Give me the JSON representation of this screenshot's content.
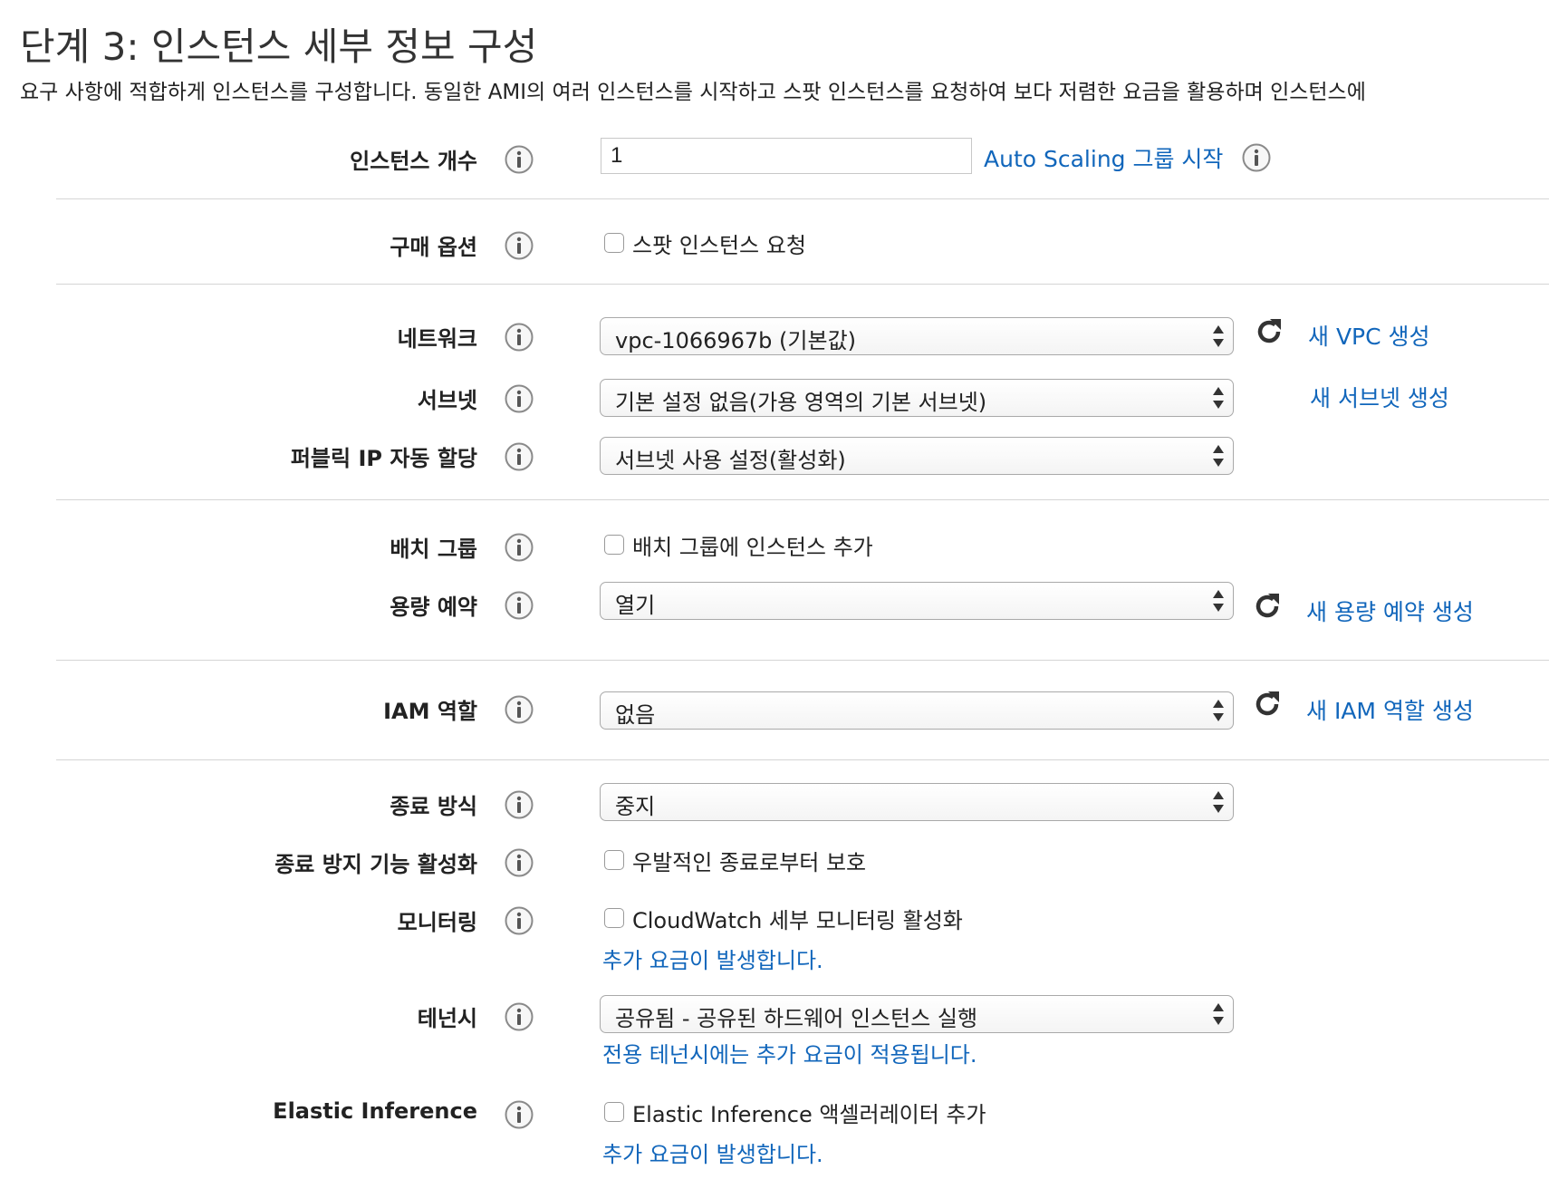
{
  "page": {
    "title": "단계 3: 인스턴스 세부 정보 구성",
    "description": "요구 사항에 적합하게 인스턴스를 구성합니다. 동일한 AMI의 여러 인스턴스를 시작하고 스팟 인스턴스를 요청하여 보다 저렴한 요금을 활용하며 인스턴스에"
  },
  "instance_count": {
    "label": "인스턴스 개수",
    "value": "1",
    "link": "Auto Scaling 그룹 시작"
  },
  "purchase_option": {
    "label": "구매 옵션",
    "checkbox_label": "스팟 인스턴스 요청"
  },
  "network": {
    "label": "네트워크",
    "value": "vpc-1066967b (기본값)",
    "link": "새 VPC 생성"
  },
  "subnet": {
    "label": "서브넷",
    "value": "기본 설정 없음(가용 영역의 기본 서브넷)",
    "link": "새 서브넷 생성"
  },
  "public_ip": {
    "label": "퍼블릭 IP 자동 할당",
    "value": "서브넷 사용 설정(활성화)"
  },
  "placement_group": {
    "label": "배치 그룹",
    "checkbox_label": "배치 그룹에 인스턴스 추가"
  },
  "capacity_reservation": {
    "label": "용량 예약",
    "value": "열기",
    "link": "새 용량 예약 생성"
  },
  "iam_role": {
    "label": "IAM 역할",
    "value": "없음",
    "link": "새 IAM 역할 생성"
  },
  "shutdown_behavior": {
    "label": "종료 방식",
    "value": "중지"
  },
  "termination_protection": {
    "label": "종료 방지 기능 활성화",
    "checkbox_label": "우발적인 종료로부터 보호"
  },
  "monitoring": {
    "label": "모니터링",
    "checkbox_label": "CloudWatch 세부 모니터링 활성화",
    "note": "추가 요금이 발생합니다."
  },
  "tenancy": {
    "label": "테넌시",
    "value": "공유됨 - 공유된 하드웨어 인스턴스 실행",
    "note": "전용 테넌시에는 추가 요금이 적용됩니다."
  },
  "elastic_inference": {
    "label": "Elastic Inference",
    "checkbox_label": "Elastic Inference 액셀러레이터 추가",
    "note": "추가 요금이 발생합니다."
  },
  "colors": {
    "link": "#1166bb",
    "text": "#222222",
    "divider": "#d5d5d5"
  }
}
